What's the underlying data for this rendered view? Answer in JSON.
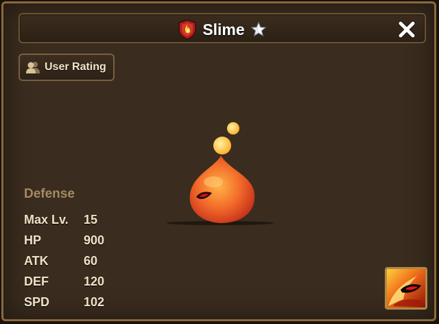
{
  "header": {
    "title": "Slime",
    "element": "fire",
    "element_icon": "fire-element-badge-icon",
    "star_icon": "star-icon",
    "close_icon": "close-icon"
  },
  "rating_button": {
    "label": "User Rating",
    "icon": "people-icon"
  },
  "monster": {
    "type": "Defense",
    "stats": [
      {
        "label": "Max Lv.",
        "value": "15"
      },
      {
        "label": "HP",
        "value": "900"
      },
      {
        "label": "ATK",
        "value": "60"
      },
      {
        "label": "DEF",
        "value": "120"
      },
      {
        "label": "SPD",
        "value": "102"
      }
    ]
  },
  "skill": {
    "icon": "fire-skill-icon"
  },
  "colors": {
    "panel": "#3a2c1e",
    "border": "#8a6a3c",
    "title_text": "#ffffff",
    "type_text": "#a48a64",
    "stat_text": "#efe3c6"
  }
}
